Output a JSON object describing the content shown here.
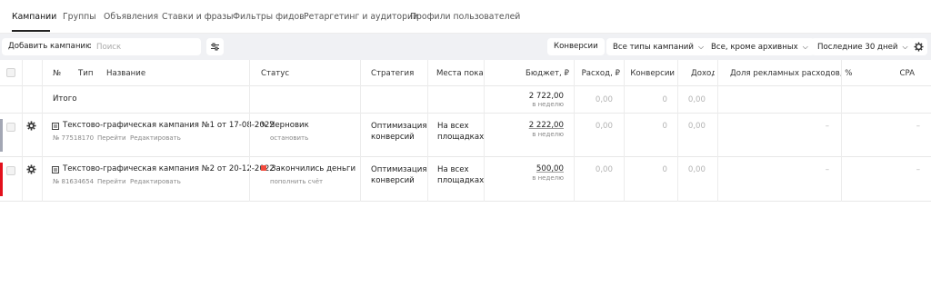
{
  "tabs": [
    {
      "label": "Кампании"
    },
    {
      "label": "Группы"
    },
    {
      "label": "Объявления"
    },
    {
      "label": "Ставки и фразы"
    },
    {
      "label": "Фильтры фидов"
    },
    {
      "label": "Ретаргетинг и аудитории"
    },
    {
      "label": "Профили пользователей"
    }
  ],
  "toolbar": {
    "add_campaign": "Добавить кампанию",
    "search_placeholder": "Поиск",
    "conversions": "Конверсии",
    "campaign_types": "Все типы кампаний",
    "archive_filter": "Все, кроме архивных",
    "period": "Последние 30 дней"
  },
  "table": {
    "headers": {
      "number": "№",
      "type": "Тип",
      "name": "Название",
      "status": "Статус",
      "strategy": "Стратегия",
      "placements": "Места показа",
      "budget": "Бюджет, ₽",
      "spend": "Расход, ₽",
      "conversions": "Конверсии",
      "income": "Доход",
      "drr": "Доля рекламных расходов, %",
      "cpa": "CPA"
    },
    "total": {
      "label": "Итого",
      "budget": "2 722,00",
      "budget_sub": "в неделю",
      "spend": "0,00",
      "conversions": "0",
      "income": "0,00"
    },
    "rows": [
      {
        "name": "Текстово-графическая кампания №1 от 17-08-2022",
        "id": "№ 77518170",
        "go_link": "Перейти",
        "edit_link": "Редактировать",
        "status": "Черновик",
        "status_action": "остановить",
        "strategy_line1": "Оптимизация",
        "strategy_line2": "конверсий",
        "placement_line1": "На всех",
        "placement_line2": "площадках",
        "budget": "2 222,00",
        "budget_sub": "в неделю",
        "spend": "0,00",
        "conversions": "0",
        "income": "0,00",
        "drr": "–",
        "cpa": "–",
        "bar_color": "#a3a7b4"
      },
      {
        "name": "Текстово-графическая кампания №2 от 20-12-2022",
        "id": "№ 81634654",
        "go_link": "Перейти",
        "edit_link": "Редактировать",
        "status": "Закончились деньги",
        "status_action": "пополнить счёт",
        "strategy_line1": "Оптимизация",
        "strategy_line2": "конверсий",
        "placement_line1": "На всех",
        "placement_line2": "площадках",
        "budget": "500,00",
        "budget_sub": "в неделю",
        "spend": "0,00",
        "conversions": "0",
        "income": "0,00",
        "drr": "–",
        "cpa": "–",
        "bar_color": "#e3101c",
        "status_color": "#f24a3d"
      }
    ]
  }
}
